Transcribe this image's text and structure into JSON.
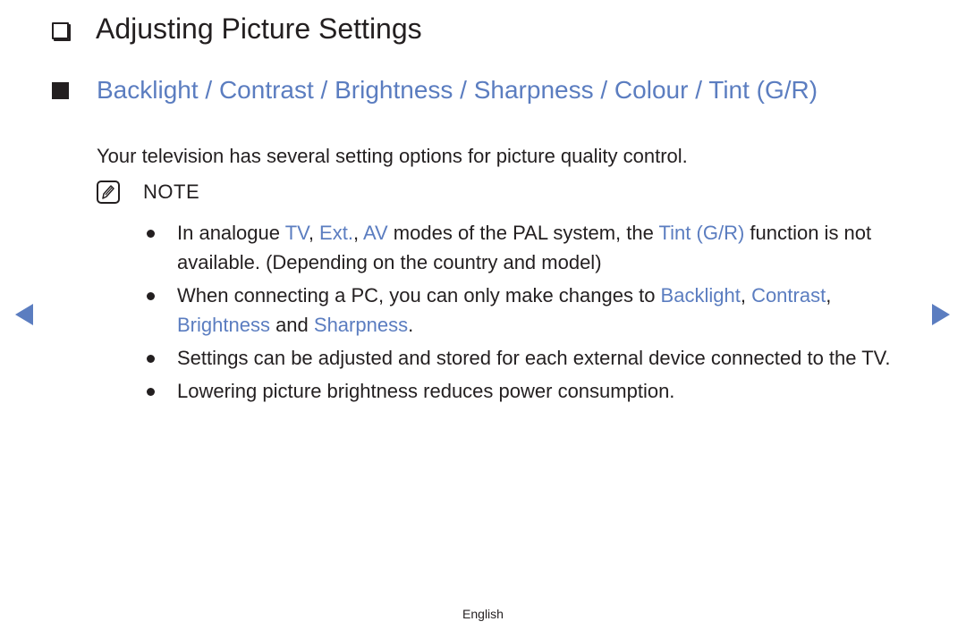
{
  "page": {
    "title": "Adjusting Picture Settings",
    "title_icon": "checkbox-square-icon",
    "section": {
      "icon": "filled-square-icon",
      "heading": "Backlight / Contrast / Brightness / Sharpness / Colour / Tint (G/R)"
    },
    "intro": "Your television has several setting options for picture quality control.",
    "note": {
      "icon": "note-pencil-icon",
      "label": "NOTE",
      "items": [
        {
          "parts": [
            {
              "t": "In analogue ",
              "hl": false
            },
            {
              "t": "TV",
              "hl": true
            },
            {
              "t": ", ",
              "hl": false
            },
            {
              "t": "Ext.",
              "hl": true
            },
            {
              "t": ", ",
              "hl": false
            },
            {
              "t": "AV",
              "hl": true
            },
            {
              "t": " modes of the PAL system, the ",
              "hl": false
            },
            {
              "t": "Tint (G/R)",
              "hl": true
            },
            {
              "t": " function is not available. (Depending on the country and model)",
              "hl": false
            }
          ]
        },
        {
          "parts": [
            {
              "t": "When connecting a PC, you can only make changes to ",
              "hl": false
            },
            {
              "t": "Backlight",
              "hl": true
            },
            {
              "t": ", ",
              "hl": false
            },
            {
              "t": "Contrast",
              "hl": true
            },
            {
              "t": ", ",
              "hl": false
            },
            {
              "t": "Brightness",
              "hl": true
            },
            {
              "t": " and ",
              "hl": false
            },
            {
              "t": "Sharpness",
              "hl": true
            },
            {
              "t": ".",
              "hl": false
            }
          ]
        },
        {
          "parts": [
            {
              "t": "Settings can be adjusted and stored for each external device connected to the TV.",
              "hl": false
            }
          ]
        },
        {
          "parts": [
            {
              "t": "Lowering picture brightness reduces power consumption.",
              "hl": false
            }
          ]
        }
      ]
    },
    "navigation": {
      "prev_icon": "triangle-left-icon",
      "next_icon": "triangle-right-icon"
    },
    "footer": "English"
  },
  "colors": {
    "accent": "#5b7dc0",
    "text": "#231f20"
  }
}
